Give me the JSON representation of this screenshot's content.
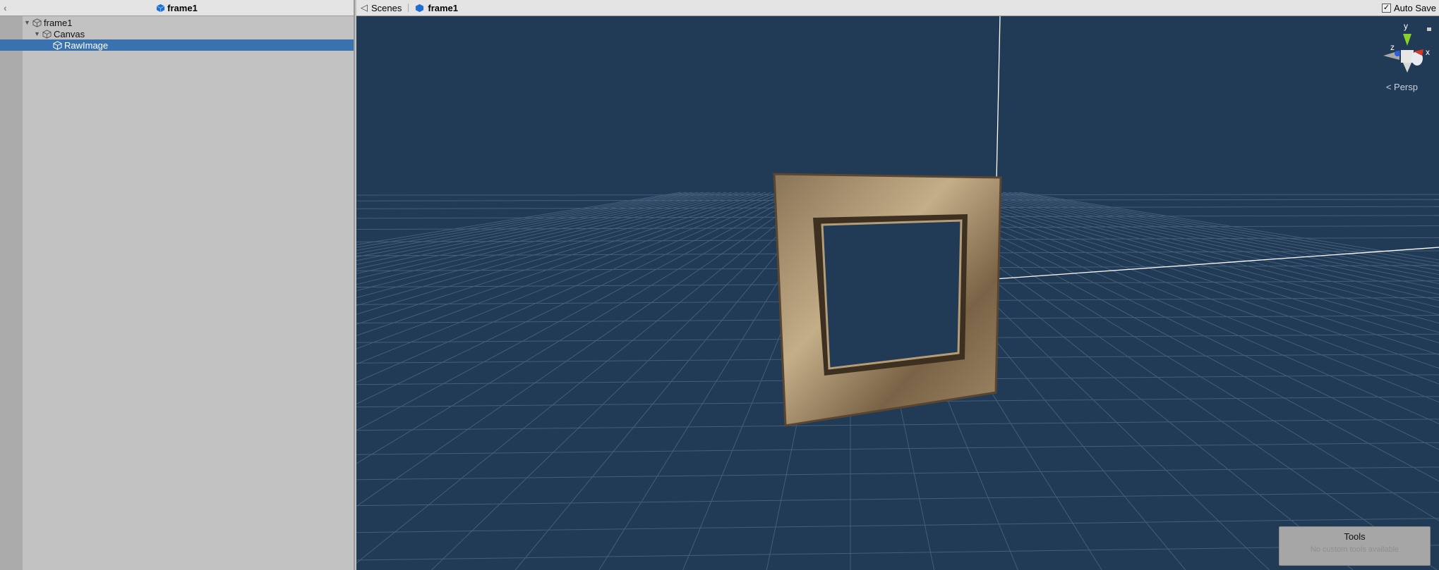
{
  "hierarchy": {
    "title": "frame1",
    "items": [
      {
        "label": "frame1"
      },
      {
        "label": "Canvas"
      },
      {
        "label": "RawImage"
      }
    ]
  },
  "scene": {
    "breadcrumb_root": "Scenes",
    "breadcrumb_current": "frame1",
    "auto_save_label": "Auto Save",
    "auto_save_checked": true,
    "projection": "Persp",
    "gizmo": {
      "y": "y",
      "x": "x",
      "z": "z"
    }
  },
  "tools": {
    "title": "Tools",
    "message": "No custom tools available"
  },
  "colors": {
    "selection": "#3a72b0",
    "scene_bg": "#213a55"
  }
}
